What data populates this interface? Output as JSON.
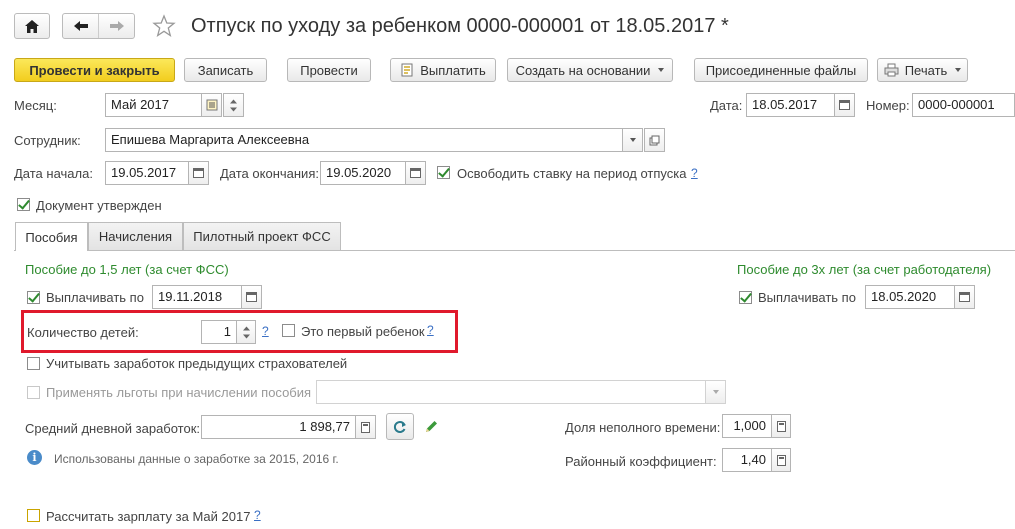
{
  "window": {
    "title": "Отпуск по уходу за ребенком 0000-000001 от 18.05.2017 *"
  },
  "toolbar": {
    "post_close": "Провести и закрыть",
    "save": "Записать",
    "post": "Провести",
    "pay": "Выплатить",
    "create_based": "Создать на основании",
    "attached_files": "Присоединенные файлы",
    "print": "Печать"
  },
  "header": {
    "month_label": "Месяц:",
    "month_value": "Май 2017",
    "date_label": "Дата:",
    "date_value": "18.05.2017",
    "number_label": "Номер:",
    "number_value": "0000-000001",
    "employee_label": "Сотрудник:",
    "employee_value": "Епишева Маргарита Алексеевна",
    "start_label": "Дата начала:",
    "start_value": "19.05.2017",
    "end_label": "Дата окончания:",
    "end_value": "19.05.2020",
    "release_rate_label": "Освободить ставку на период отпуска",
    "help": "?",
    "approved_label": "Документ утвержден"
  },
  "tabs": [
    {
      "label": "Пособия"
    },
    {
      "label": "Начисления"
    },
    {
      "label": "Пилотный проект ФСС"
    }
  ],
  "benefits": {
    "left_title": "Пособие до 1,5 лет (за счет ФСС)",
    "right_title": "Пособие до 3х лет (за счет работодателя)",
    "pay_until_label": "Выплачивать по",
    "pay_until_left": "19.11.2018",
    "pay_until_right": "18.05.2020",
    "children_label": "Количество детей:",
    "children_value": "1",
    "first_child_label": "Это первый ребенок",
    "prev_insurers_label": "Учитывать заработок предыдущих страхователей",
    "apply_benefits_label": "Применять льготы при начислении пособия",
    "avg_earnings_label": "Средний дневной заработок:",
    "avg_earnings_value": "1 898,77",
    "part_time_label": "Доля неполного времени:",
    "part_time_value": "1,000",
    "regional_label": "Районный коэффициент:",
    "regional_value": "1,40",
    "info_text": "Использованы данные о заработке за  2015,  2016 г.",
    "calc_salary_label": "Рассчитать зарплату за Май 2017",
    "help": "?"
  },
  "colors": {
    "accent_green": "#2e8b2e",
    "highlight_red": "#e0192c",
    "primary_button": "#f2cd1e",
    "help_link": "#3a6fc4"
  }
}
